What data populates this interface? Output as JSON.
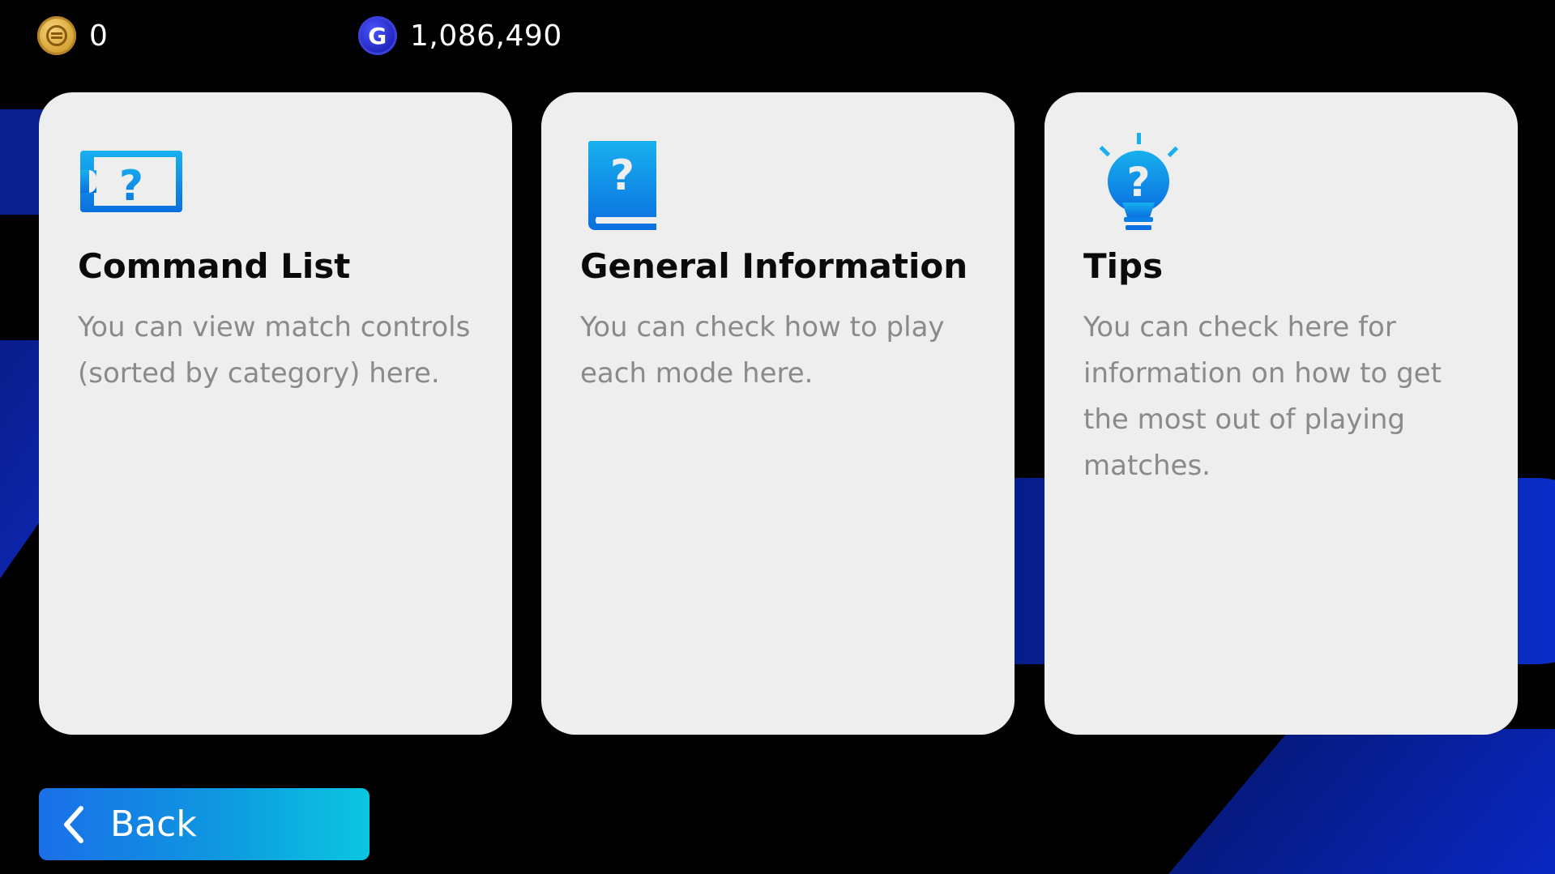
{
  "currencies": {
    "coins": {
      "icon": "coin-icon",
      "value": "0"
    },
    "gp": {
      "icon": "gp-icon",
      "icon_letter": "G",
      "value": "1,086,490"
    }
  },
  "cards": [
    {
      "icon": "command-list-icon",
      "title": "Command List",
      "description": "You can view match controls (sorted by category) here."
    },
    {
      "icon": "book-question-icon",
      "title": "General Information",
      "description": "You can check how to play each mode here."
    },
    {
      "icon": "lightbulb-question-icon",
      "title": "Tips",
      "description": "You can check here for information on how to get the most out of playing matches."
    }
  ],
  "back_button": {
    "icon": "chevron-left-icon",
    "label": "Back"
  },
  "colors": {
    "background": "#000000",
    "card": "#eeeeee",
    "icon_blue": "#0a8fe8",
    "button_gradient_start": "#1a6fe8",
    "button_gradient_end": "#0ac7e0"
  }
}
